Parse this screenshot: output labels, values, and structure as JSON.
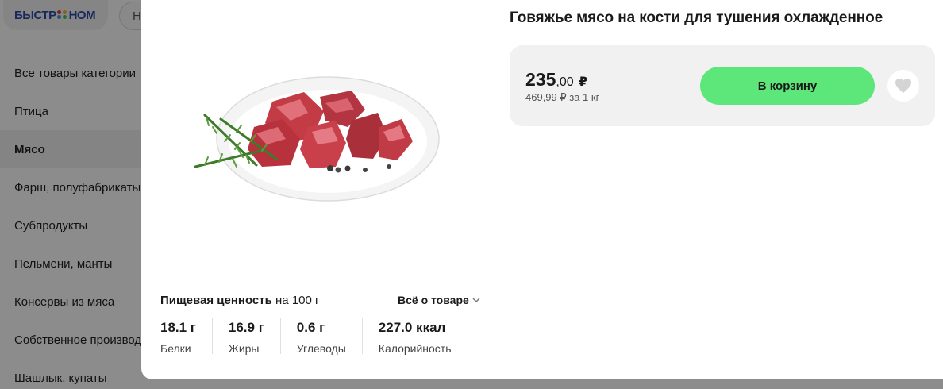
{
  "background": {
    "logo_text_left": "БЫСТР",
    "logo_text_right": "НОМ",
    "search_stub": "Н",
    "categories": [
      {
        "label": "Все товары категории"
      },
      {
        "label": "Птица"
      },
      {
        "label": "Мясо"
      },
      {
        "label": "Фарш, полуфабрикаты"
      },
      {
        "label": "Субпродукты"
      },
      {
        "label": "Пельмени, манты"
      },
      {
        "label": "Консервы из мяса"
      },
      {
        "label": "Собственное производство"
      },
      {
        "label": "Шашлык, купаты"
      }
    ],
    "active_category": "Мясо"
  },
  "product": {
    "title": "Говяжье мясо на кости для тушения охлажденное",
    "image_icon": "meat-plate-image",
    "price_int": "235",
    "price_kop": ",00",
    "currency": "₽",
    "price_per_unit": "469,99 ₽ за 1 кг",
    "cart_label": "В корзину",
    "favorite_icon": "heart-icon"
  },
  "nutrition": {
    "heading_bold": "Пищевая ценность",
    "heading_rest": " на 100 г",
    "about_link": "Всё о товаре",
    "items": [
      {
        "value": "18.1 г",
        "label": "Белки"
      },
      {
        "value": "16.9 г",
        "label": "Жиры"
      },
      {
        "value": "0.6 г",
        "label": "Углеводы"
      },
      {
        "value": "227.0 ккал",
        "label": "Калорийность"
      }
    ]
  },
  "colors": {
    "accent_green": "#5de77a",
    "card_bg": "#f1f1f1",
    "logo_blue": "#2b4aa8"
  }
}
